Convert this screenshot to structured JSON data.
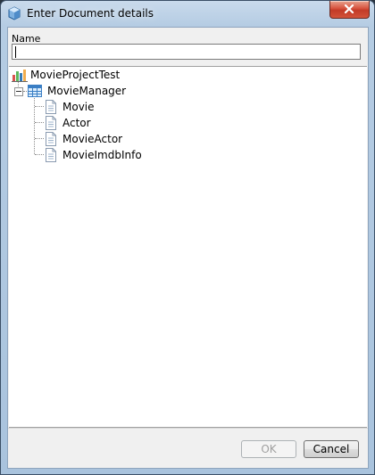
{
  "window": {
    "title": "Enter Document details",
    "icon": "app-cube-icon"
  },
  "form": {
    "name_label": "Name",
    "name_value": ""
  },
  "tree": {
    "root": {
      "label": "MovieProjectTest",
      "icon": "project-icon"
    },
    "group": {
      "label": "MovieManager",
      "icon": "table-icon",
      "expanded": true
    },
    "documents": [
      {
        "label": "Movie",
        "icon": "document-icon"
      },
      {
        "label": "Actor",
        "icon": "document-icon"
      },
      {
        "label": "MovieActor",
        "icon": "document-icon"
      },
      {
        "label": "MovieImdbInfo",
        "icon": "document-icon"
      }
    ]
  },
  "buttons": {
    "ok_label": "OK",
    "ok_enabled": false,
    "cancel_label": "Cancel"
  },
  "colors": {
    "frame": "#b5cce3",
    "close": "#c23b27",
    "client": "#f0f0f0"
  }
}
